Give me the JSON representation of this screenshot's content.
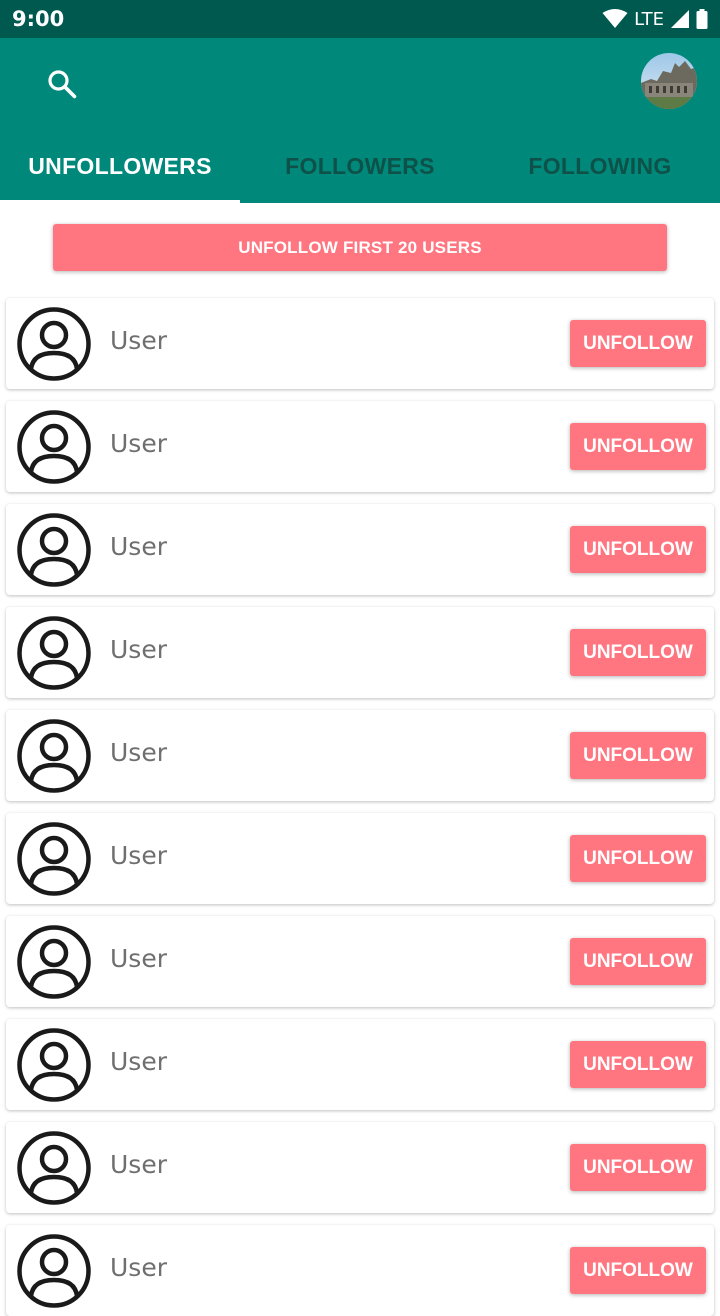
{
  "status_bar": {
    "time": "9:00",
    "network": "LTE"
  },
  "app_bar": {
    "search_icon": "search-icon",
    "profile_avatar": "profile-photo"
  },
  "tabs": [
    {
      "label": "UNFOLLOWERS",
      "active": true
    },
    {
      "label": "FOLLOWERS",
      "active": false
    },
    {
      "label": "FOLLOWING",
      "active": false
    }
  ],
  "bulk_action": {
    "label": "UNFOLLOW FIRST 20 USERS"
  },
  "users": [
    {
      "name": "User",
      "button": "UNFOLLOW"
    },
    {
      "name": "User",
      "button": "UNFOLLOW"
    },
    {
      "name": "User",
      "button": "UNFOLLOW"
    },
    {
      "name": "User",
      "button": "UNFOLLOW"
    },
    {
      "name": "User",
      "button": "UNFOLLOW"
    },
    {
      "name": "User",
      "button": "UNFOLLOW"
    },
    {
      "name": "User",
      "button": "UNFOLLOW"
    },
    {
      "name": "User",
      "button": "UNFOLLOW"
    },
    {
      "name": "User",
      "button": "UNFOLLOW"
    },
    {
      "name": "User",
      "button": "UNFOLLOW"
    }
  ],
  "colors": {
    "status_bar": "#00594f",
    "primary": "#00897b",
    "inactive_tab": "#0e5149",
    "accent_button": "#ff7580",
    "user_name": "#6f6f6f"
  }
}
